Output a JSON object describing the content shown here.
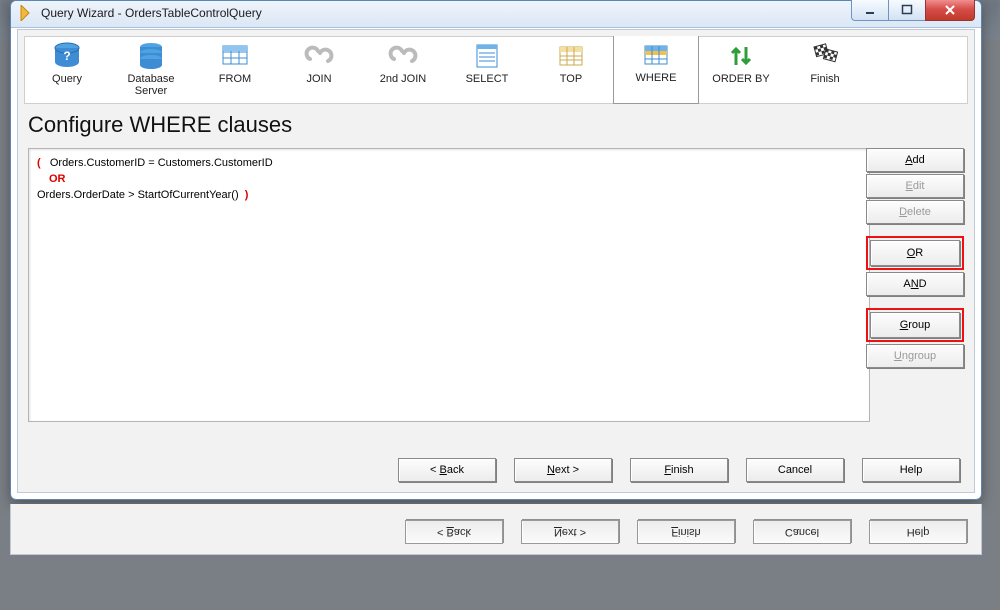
{
  "window": {
    "title": "Query Wizard - OrdersTableControlQuery"
  },
  "toolbar": {
    "items": [
      {
        "label": "Query"
      },
      {
        "label": "Database\nServer"
      },
      {
        "label": "FROM"
      },
      {
        "label": "JOIN"
      },
      {
        "label": "2nd JOIN"
      },
      {
        "label": "SELECT"
      },
      {
        "label": "TOP"
      },
      {
        "label": "WHERE"
      },
      {
        "label": "ORDER BY"
      },
      {
        "label": "Finish"
      }
    ]
  },
  "heading": "Configure WHERE clauses",
  "clauses": {
    "open_paren": "(",
    "line1": "Orders.CustomerID = Customers.CustomerID",
    "or": "OR",
    "line2": "Orders.OrderDate > StartOfCurrentYear()",
    "close_paren": ")"
  },
  "side": {
    "add": {
      "pre": "",
      "ul": "A",
      "post": "dd"
    },
    "edit": {
      "pre": "",
      "ul": "E",
      "post": "dit"
    },
    "delete": {
      "pre": "",
      "ul": "D",
      "post": "elete"
    },
    "or": {
      "pre": "",
      "ul": "O",
      "post": "R"
    },
    "and": {
      "pre": "A",
      "ul": "N",
      "post": "D"
    },
    "group": {
      "pre": "",
      "ul": "G",
      "post": "roup"
    },
    "ungroup": {
      "pre": "",
      "ul": "U",
      "post": "ngroup"
    }
  },
  "nav": {
    "back": {
      "pre": "< ",
      "ul": "B",
      "post": "ack"
    },
    "next": {
      "pre": "",
      "ul": "N",
      "post": "ext >"
    },
    "finish": {
      "pre": "",
      "ul": "F",
      "post": "inish"
    },
    "cancel": {
      "text": "Cancel"
    },
    "help": {
      "text": "Help"
    }
  }
}
